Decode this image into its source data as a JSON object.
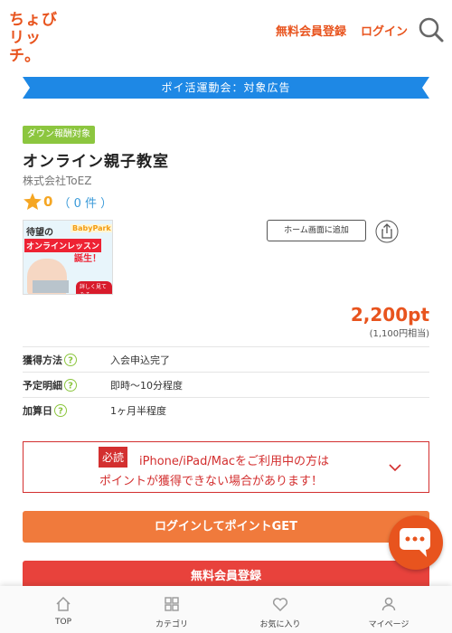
{
  "header": {
    "logo_line1": "ちょび",
    "logo_line2": "リッチ。",
    "register_label": "無料会員登録",
    "login_label": "ログイン"
  },
  "banner": {
    "text": "ポイ活運動会：対象広告",
    "color": "#1e88e5"
  },
  "offer": {
    "badge": "ダウン報酬対象",
    "title": "オンライン親子教室",
    "company": "株式会社ToEZ",
    "rating_score": "0",
    "rating_count": "（ 0 件 ）",
    "thumbnail": {
      "line1": "待望の",
      "line2": "オンラインレッスン",
      "line3": "誕生！",
      "brand": "BabyPark",
      "cta": "詳しく見てみる"
    },
    "add_home_label": "ホーム画面に追加",
    "points": "2,200pt",
    "points_yen": "(1,100円相当)"
  },
  "details": [
    {
      "label": "獲得方法",
      "value": "入会申込完了"
    },
    {
      "label": "予定明細",
      "value": "即時～10分程度"
    },
    {
      "label": "加算日",
      "value": "1ヶ月半程度"
    }
  ],
  "notice": {
    "tag": "必読",
    "line1": "iPhone/iPad/Macをご利用中の方は",
    "line2": "ポイントが獲得できない場合があります！"
  },
  "actions": {
    "login_point": "ログインしてポイントGET",
    "register": "無料会員登録"
  },
  "bottom_nav": [
    {
      "label": "TOP",
      "icon": "home-icon"
    },
    {
      "label": "カテゴリ",
      "icon": "category-icon"
    },
    {
      "label": "お気に入り",
      "icon": "heart-icon"
    },
    {
      "label": "マイページ",
      "icon": "user-icon"
    }
  ],
  "colors": {
    "brand": "#e8541e",
    "badge": "#8cc63f",
    "notice": "#d32f2f",
    "link": "#3a9ad9"
  }
}
